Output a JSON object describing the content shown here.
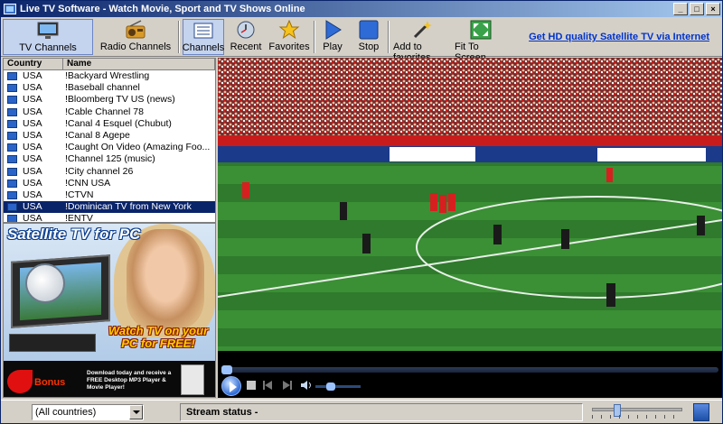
{
  "window": {
    "title": "Live TV Software - Watch Movie, Sport and TV Shows Online",
    "controls": {
      "minimize": "_",
      "maximize": "□",
      "close": "×"
    }
  },
  "toolbar": {
    "tv_channels": "TV Channels",
    "radio_channels": "Radio Channels",
    "channels": "Channels",
    "recent": "Recent",
    "favorites": "Favorites",
    "play": "Play",
    "stop": "Stop",
    "add_to_favorites": "Add to favorites",
    "fit_to_screen": "Fit To Screen",
    "promo_link": "Get HD quality Satellite TV via Internet"
  },
  "channel_list": {
    "columns": {
      "country": "Country",
      "name": "Name"
    },
    "rows": [
      {
        "country": "USA",
        "name": "!Backyard Wrestling"
      },
      {
        "country": "USA",
        "name": "!Baseball channel"
      },
      {
        "country": "USA",
        "name": "!Bloomberg TV US (news)"
      },
      {
        "country": "USA",
        "name": "!Cable Channel 78"
      },
      {
        "country": "USA",
        "name": "!Canal 4 Esquel (Chubut)"
      },
      {
        "country": "USA",
        "name": "!Canal 8 Agepe"
      },
      {
        "country": "USA",
        "name": "!Caught On Video (Amazing Foo..."
      },
      {
        "country": "USA",
        "name": "!Channel 125 (music)"
      },
      {
        "country": "USA",
        "name": "!City channel 26"
      },
      {
        "country": "USA",
        "name": "!CNN USA"
      },
      {
        "country": "USA",
        "name": "!CTVN"
      },
      {
        "country": "USA",
        "name": "!Dominican TV from New York",
        "selected": true
      },
      {
        "country": "USA",
        "name": "!ENTV"
      }
    ]
  },
  "ad": {
    "headline": "Satellite TV for PC",
    "watch_line1": "Watch TV on your",
    "watch_line2": "PC for FREE!",
    "bonus": "Bonus",
    "bonus_text": "Download today and receive a FREE Desktop MP3 Player & Movie Player!"
  },
  "status": {
    "country_filter": "(All countries)",
    "stream_status": "Stream status -"
  },
  "colors": {
    "titlebar_start": "#0a246a",
    "titlebar_end": "#a6caf0",
    "selection": "#0a246a",
    "link": "#0033cc"
  }
}
